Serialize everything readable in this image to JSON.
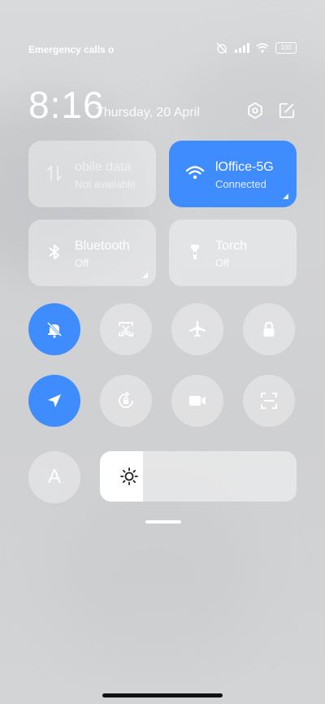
{
  "status_bar": {
    "left_text": "Emergency calls o",
    "battery": "100"
  },
  "header": {
    "time": "8:16",
    "date": "Thursday, 20 April"
  },
  "tiles": {
    "mobile_data": {
      "title": "obile data",
      "subtitle": "Not available"
    },
    "wifi": {
      "title": "lOffice-5G",
      "subtitle": "Connected"
    },
    "bluetooth": {
      "title": "Bluetooth",
      "subtitle": "Off"
    },
    "torch": {
      "title": "Torch",
      "subtitle": "Off"
    }
  },
  "brightness": {
    "auto_label": "A",
    "level_fraction": 0.22
  },
  "colors": {
    "accent": "#3f8cff"
  }
}
